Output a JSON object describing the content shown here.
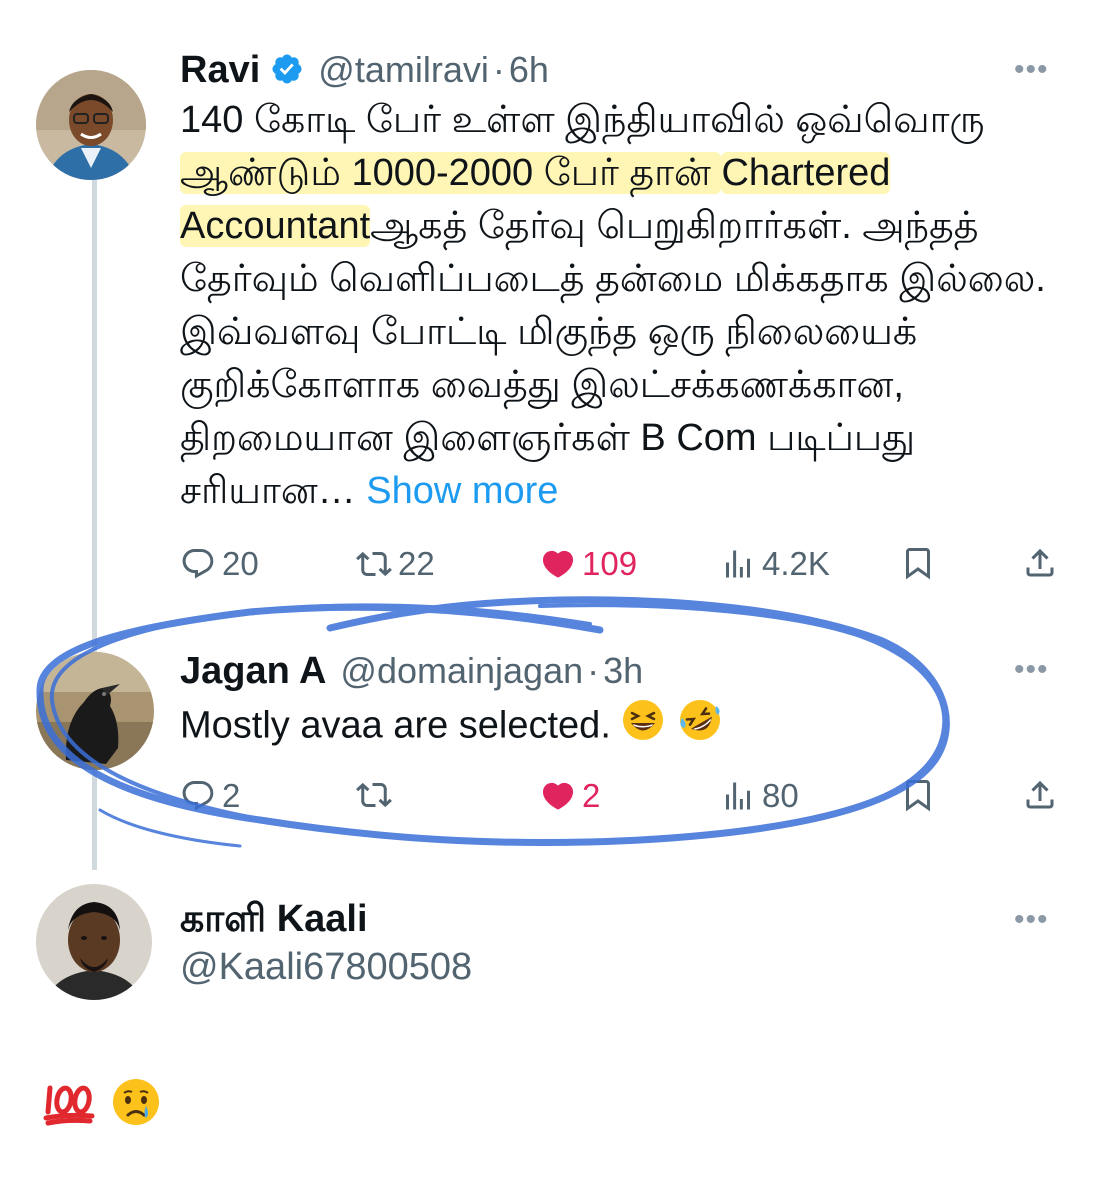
{
  "tweet": {
    "name": "Ravi",
    "handle": "@tamilravi",
    "dot": "·",
    "time": "6h",
    "more": "•••",
    "lines": [
      "140 கோடி பேர் உள்ள இந்தியாவில் ஒவ்வொரு",
      "ஆண்டும் 1000-2000 பேர் தான் ",
      "Chartered",
      "Accountant",
      "ஆகத் தேர்வு பெறுகிறார்கள். அந்தத்",
      "தேர்வும் வெளிப்படைத் தன்மை மிக்கதாக இல்லை.",
      "இவ்வளவு போட்டி மிகுந்த ஒரு நிலையைக்",
      "குறிக்கோளாக வைத்து இலட்சக்கணக்கான,",
      "திறமையான இளைஞர்கள் B Com படிப்பது",
      "சரியான… "
    ],
    "show_more": "Show more",
    "replies": "20",
    "reposts": "22",
    "likes": "109",
    "views": "4.2K"
  },
  "reply": {
    "name": "Jagan A",
    "handle": "@domainjagan",
    "dot": "·",
    "time": "3h",
    "more": "•••",
    "text": "Mostly avaa are selected.",
    "replies": "2",
    "likes": "2",
    "views": "80"
  },
  "compose": {
    "name": "காளி Kaali",
    "handle": "@Kaali67800508",
    "more": "•••"
  },
  "colors": {
    "accent": "#1d9bf0",
    "like": "#e0245e",
    "muted": "#536471",
    "scribble": "#3a6fd8",
    "highlight": "#ffec78"
  },
  "icons": [
    "verified-badge-icon",
    "reply-icon",
    "repost-icon",
    "like-icon",
    "views-icon",
    "bookmark-icon",
    "share-icon",
    "grin-squint-emoji",
    "rofl-emoji",
    "hundred-points-emoji",
    "crying-face-emoji"
  ]
}
